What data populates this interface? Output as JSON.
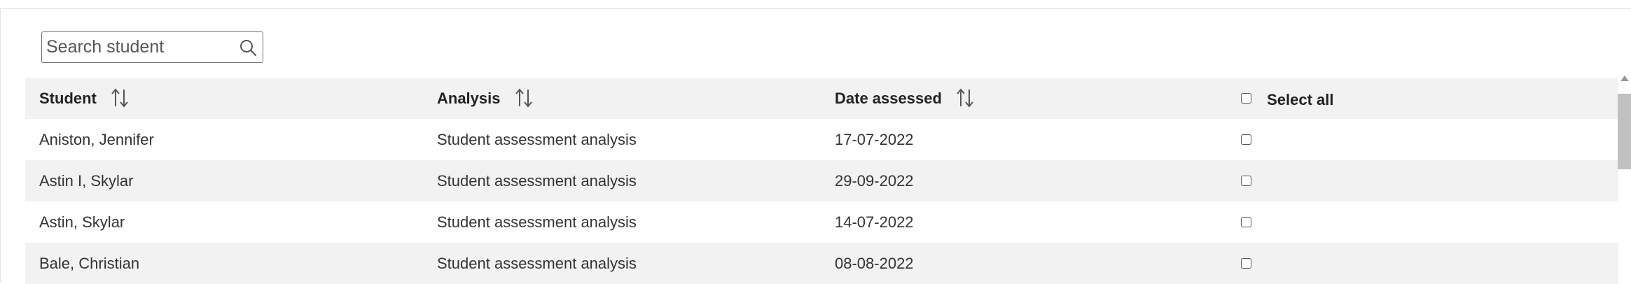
{
  "search": {
    "placeholder": "Search student",
    "icon": "search-icon"
  },
  "table": {
    "headers": {
      "student": "Student",
      "analysis": "Analysis",
      "date": "Date assessed",
      "select_all": "Select all"
    },
    "rows": [
      {
        "student": "Aniston, Jennifer",
        "analysis": "Student assessment analysis",
        "date": "17-07-2022",
        "selected": false
      },
      {
        "student": "Astin I, Skylar",
        "analysis": "Student assessment analysis",
        "date": "29-09-2022",
        "selected": false
      },
      {
        "student": "Astin, Skylar",
        "analysis": "Student assessment analysis",
        "date": "14-07-2022",
        "selected": false
      },
      {
        "student": "Bale, Christian",
        "analysis": "Student assessment analysis",
        "date": "08-08-2022",
        "selected": false
      }
    ]
  },
  "colors": {
    "row_shade": "#f2f2f2",
    "border": "#6f6f6f",
    "text": "#333333"
  }
}
